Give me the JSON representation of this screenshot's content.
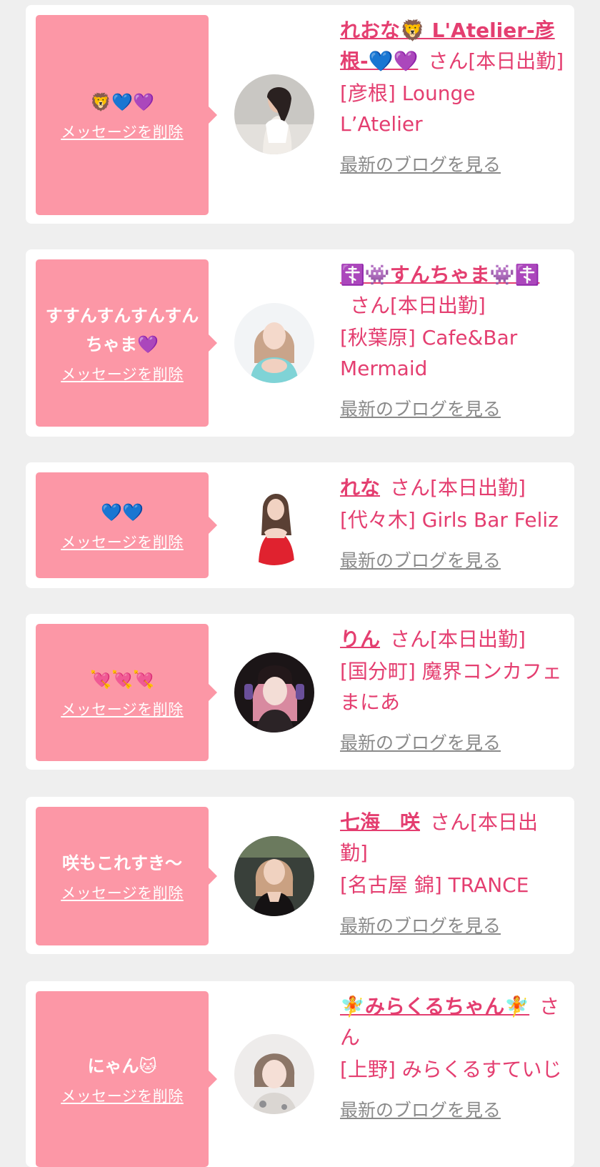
{
  "colors": {
    "page_bg": "#efefef",
    "card_bg": "#ffffff",
    "bubble": "#fc97a6",
    "accent": "#e43e70",
    "muted": "#8a8a8a"
  },
  "cards": [
    {
      "message": "🦁💙💜",
      "delete_label": "メッセージを削除",
      "name": "れおな🦁 L'Atelier-彦根-💙💜",
      "honorific": "さん[本日出勤]",
      "shop": "[彦根] Lounge L’Atelier",
      "blog_label": "最新のブログを見る",
      "avatar_icon": "portrait-photo-1"
    },
    {
      "message": "すすんすんすんすんちゃま💜",
      "delete_label": "メッセージを削除",
      "name": "☦️👾すんちゃま👾☦️",
      "honorific": "さん[本日出勤]",
      "shop": "[秋葉原] Cafe&Bar Mermaid",
      "blog_label": "最新のブログを見る",
      "avatar_icon": "portrait-photo-2"
    },
    {
      "message": "💙💙",
      "delete_label": "メッセージを削除",
      "name": "れな",
      "honorific": "さん[本日出勤]",
      "shop": "[代々木] Girls Bar Feliz",
      "blog_label": "最新のブログを見る",
      "avatar_icon": "portrait-photo-3"
    },
    {
      "message": "💘💘💘",
      "delete_label": "メッセージを削除",
      "name": "りん",
      "honorific": "さん[本日出勤]",
      "shop": "[国分町] 魔界コンカフェ まにあ",
      "blog_label": "最新のブログを見る",
      "avatar_icon": "portrait-photo-4"
    },
    {
      "message": "咲もこれすき〜",
      "delete_label": "メッセージを削除",
      "name": "七海　咲",
      "honorific": "さん[本日出勤]",
      "shop": "[名古屋 錦] TRANCE",
      "blog_label": "最新のブログを見る",
      "avatar_icon": "portrait-photo-5"
    },
    {
      "message": "にゃん🐱",
      "delete_label": "メッセージを削除",
      "name": "🧚みらくるちゃん🧚",
      "honorific": "さん",
      "shop": "[上野] みらくるすていじ",
      "blog_label": "最新のブログを見る",
      "avatar_icon": "portrait-photo-6"
    }
  ]
}
